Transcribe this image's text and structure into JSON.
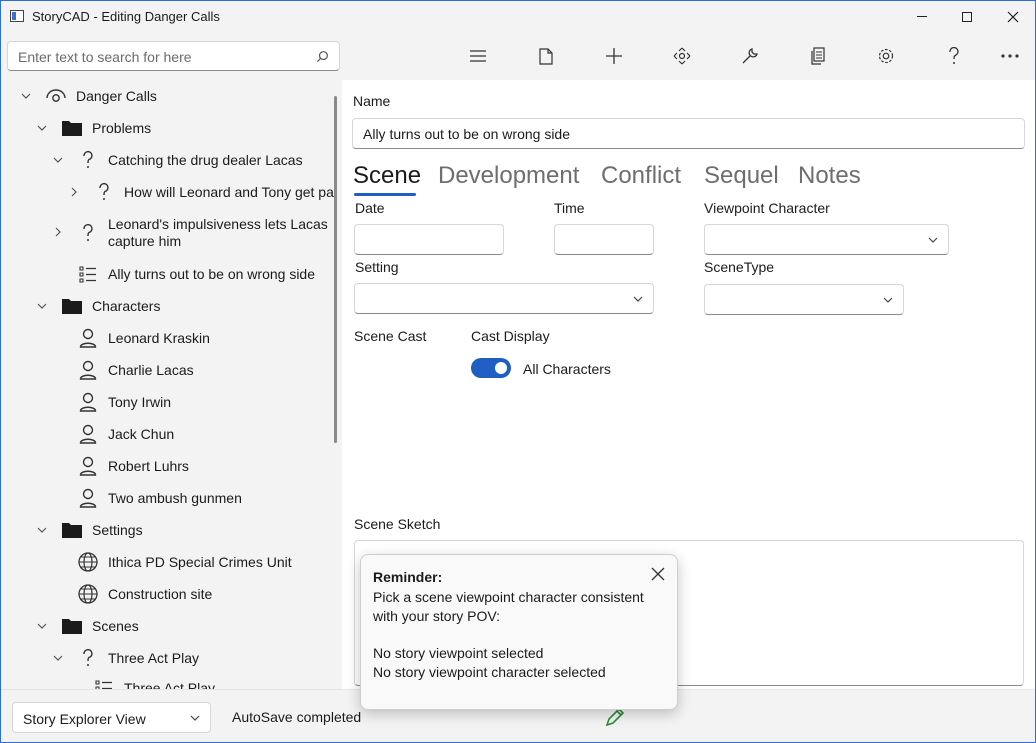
{
  "window": {
    "title": "StoryCAD - Editing Danger Calls"
  },
  "search": {
    "placeholder": "Enter text to search for here"
  },
  "tree": {
    "items": [
      {
        "label": "Danger Calls",
        "icon": "eye-icon",
        "chevron": "down"
      },
      {
        "label": "Problems",
        "icon": "folder-icon",
        "chevron": "down"
      },
      {
        "label": "Catching the drug dealer Lacas",
        "icon": "question-icon",
        "chevron": "down"
      },
      {
        "label": "How will Leonard and Tony get pas",
        "icon": "question-icon",
        "chevron": "right"
      },
      {
        "label": "Leonard's impulsiveness lets Lacas",
        "label2": "capture him",
        "icon": "question-icon",
        "chevron": "right"
      },
      {
        "label": "Ally turns out to be on wrong side",
        "icon": "list-icon",
        "chevron": ""
      },
      {
        "label": "Characters",
        "icon": "folder-icon",
        "chevron": "down"
      },
      {
        "label": "Leonard Kraskin",
        "icon": "person-icon",
        "chevron": ""
      },
      {
        "label": "Charlie Lacas",
        "icon": "person-icon",
        "chevron": ""
      },
      {
        "label": "Tony Irwin",
        "icon": "person-icon",
        "chevron": ""
      },
      {
        "label": "Jack Chun",
        "icon": "person-icon",
        "chevron": ""
      },
      {
        "label": "Robert Luhrs",
        "icon": "person-icon",
        "chevron": ""
      },
      {
        "label": "Two ambush gunmen",
        "icon": "person-icon",
        "chevron": ""
      },
      {
        "label": "Settings",
        "icon": "folder-icon",
        "chevron": "down"
      },
      {
        "label": "Ithica PD Special Crimes Unit",
        "icon": "globe-icon",
        "chevron": ""
      },
      {
        "label": "Construction site",
        "icon": "globe-icon",
        "chevron": ""
      },
      {
        "label": "Scenes",
        "icon": "folder-icon",
        "chevron": "down"
      },
      {
        "label": "Three Act Play",
        "icon": "question-icon",
        "chevron": "down"
      },
      {
        "label": "Three Act Play",
        "icon": "list-icon",
        "chevron": ""
      }
    ]
  },
  "toolbar": {
    "icons": [
      "menu-icon",
      "document-icon",
      "add-icon",
      "move-icon",
      "wrench-icon",
      "copy-icon",
      "settings-icon",
      "help-icon",
      "more-icon"
    ]
  },
  "form": {
    "name_label": "Name",
    "name_value": "Ally turns out to be on wrong side",
    "tabs": [
      "Scene",
      "Development",
      "Conflict",
      "Sequel",
      "Notes"
    ],
    "active_tab": "Scene",
    "date_label": "Date",
    "time_label": "Time",
    "viewpoint_label": "Viewpoint Character",
    "setting_label": "Setting",
    "scenetype_label": "SceneType",
    "scene_cast_label": "Scene Cast",
    "cast_display_label": "Cast Display",
    "toggle_label": "All Characters",
    "toggle_on": true,
    "sketch_label": "Scene Sketch"
  },
  "status": {
    "view_value": "Story Explorer View",
    "autosave": "AutoSave completed"
  },
  "reminder": {
    "title": "Reminder:",
    "line1": "Pick a scene viewpoint character consistent",
    "line2": "with your story POV:",
    "line3": "No story viewpoint selected",
    "line4": "No story viewpoint character selected"
  },
  "colors": {
    "accent": "#1f5fc4",
    "pencil": "#2e8b3a"
  }
}
